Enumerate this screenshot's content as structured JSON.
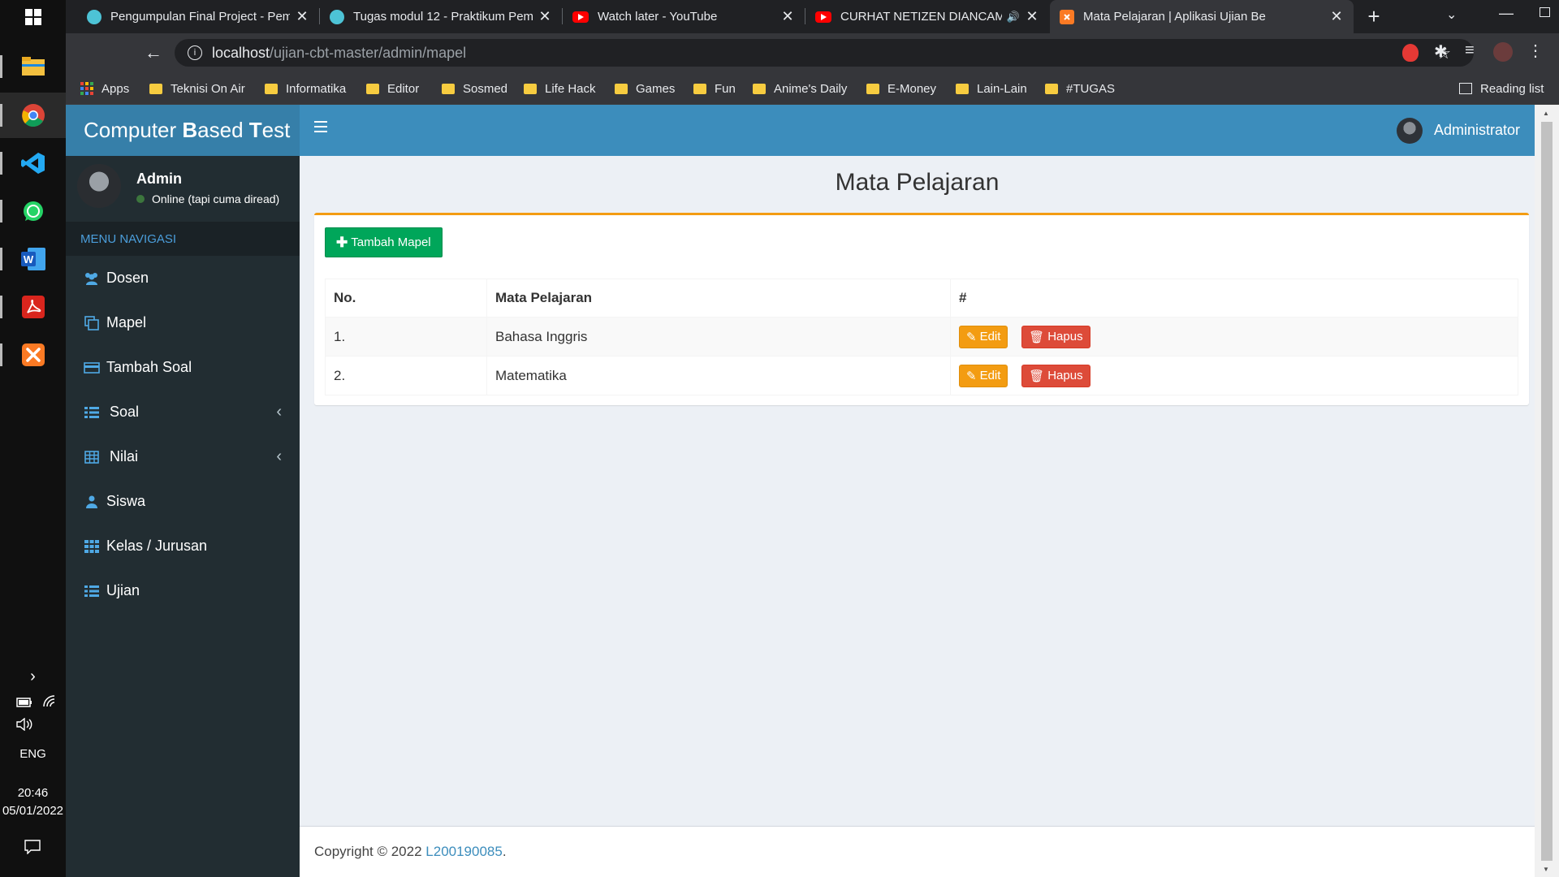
{
  "taskbar": {
    "apps": [
      "windows-start",
      "file-explorer",
      "chrome",
      "vscode",
      "whatsapp",
      "word",
      "acrobat",
      "xampp"
    ],
    "language": "ENG",
    "time": "20:46",
    "date": "05/01/2022"
  },
  "browser": {
    "tabs": [
      {
        "title": "Pengumpulan Final Project - Pem",
        "favicon": "moodle-icon"
      },
      {
        "title": "Tugas modul 12 - Praktikum Pem",
        "favicon": "moodle-icon"
      },
      {
        "title": "Watch later - YouTube",
        "favicon": "youtube-icon"
      },
      {
        "title": "CURHAT NETIZEN DIANCAM",
        "favicon": "youtube-icon"
      },
      {
        "title": "Mata Pelajaran | Aplikasi Ujian Be",
        "favicon": "xampp-icon"
      }
    ],
    "url_host": "localhost",
    "url_path": "/ujian-cbt-master/admin/mapel",
    "bookmarks": [
      "Apps",
      "Teknisi On Air",
      "Informatika",
      "Editor",
      "Sosmed",
      "Life Hack",
      "Games",
      "Fun",
      "Anime's Daily",
      "E-Money",
      "Lain-Lain",
      "#TUGAS"
    ],
    "reading_list": "Reading list"
  },
  "app": {
    "logo_bold": "Computer ",
    "logo_b": "B",
    "logo_rest": "ased ",
    "logo_t": "T",
    "logo_end": "est",
    "user_name": "Administrator",
    "panel_name": "Admin",
    "panel_status": "Online (tapi cuma diread)",
    "menu_header": "MENU NAVIGASI",
    "menu": [
      {
        "label": "Dosen",
        "icon": "users-icon"
      },
      {
        "label": "Mapel",
        "icon": "copy-icon"
      },
      {
        "label": "Tambah Soal",
        "icon": "card-icon"
      },
      {
        "label": "Soal",
        "icon": "list-icon"
      },
      {
        "label": "Nilai",
        "icon": "table-icon"
      },
      {
        "label": "Siswa",
        "icon": "user-icon"
      },
      {
        "label": "Kelas / Jurusan",
        "icon": "grid-icon"
      },
      {
        "label": "Ujian",
        "icon": "list-icon"
      }
    ],
    "page_title": "Mata Pelajaran",
    "add_button": "Tambah Mapel",
    "table": {
      "headers": [
        "No.",
        "Mata Pelajaran",
        "#"
      ],
      "rows": [
        {
          "no": "1.",
          "name": "Bahasa Inggris"
        },
        {
          "no": "2.",
          "name": "Matematika"
        }
      ],
      "edit_label": "Edit",
      "delete_label": "Hapus"
    },
    "footer_prefix": "Copyright © 2022 ",
    "footer_link": "L200190085",
    "footer_suffix": ".",
    "colors": {
      "header": "#3c8dbc",
      "logo": "#367fa9",
      "sidebar": "#222d32",
      "success": "#00a65a",
      "warning": "#f39c12",
      "danger": "#dd4b39"
    }
  }
}
